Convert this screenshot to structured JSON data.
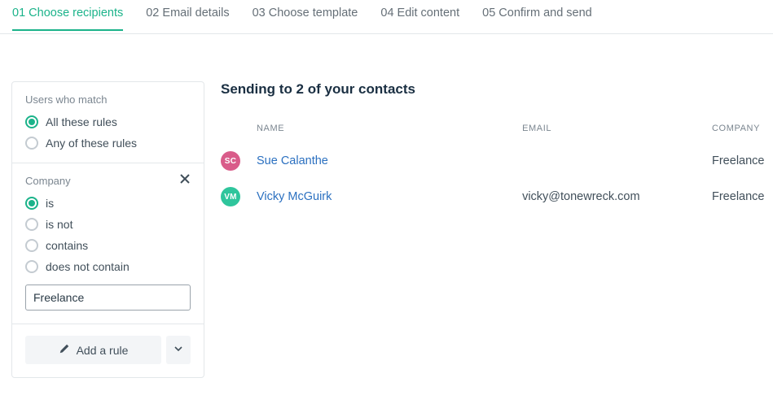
{
  "tabs": [
    {
      "label": "01 Choose recipients",
      "active": true
    },
    {
      "label": "02 Email details",
      "active": false
    },
    {
      "label": "03 Choose template",
      "active": false
    },
    {
      "label": "04 Edit content",
      "active": false
    },
    {
      "label": "05 Confirm and send",
      "active": false
    }
  ],
  "filter_panel": {
    "match_label": "Users who match",
    "match_options": [
      {
        "label": "All these rules",
        "checked": true
      },
      {
        "label": "Any of these rules",
        "checked": false
      }
    ],
    "rule": {
      "field_label": "Company",
      "operator_options": [
        {
          "label": "is",
          "checked": true
        },
        {
          "label": "is not",
          "checked": false
        },
        {
          "label": "contains",
          "checked": false
        },
        {
          "label": "does not contain",
          "checked": false
        }
      ],
      "value": "Freelance"
    },
    "add_rule_label": "Add a rule"
  },
  "main": {
    "heading": "Sending to 2 of your contacts",
    "columns": {
      "name": "NAME",
      "email": "EMAIL",
      "company": "COMPANY"
    },
    "rows": [
      {
        "initials": "SC",
        "avatar_color": "#d95c8a",
        "name": "Sue Calanthe",
        "email": "",
        "company": "Freelance"
      },
      {
        "initials": "VM",
        "avatar_color": "#2fc59c",
        "name": "Vicky McGuirk",
        "email": "vicky@tonewreck.com",
        "company": "Freelance"
      }
    ]
  }
}
